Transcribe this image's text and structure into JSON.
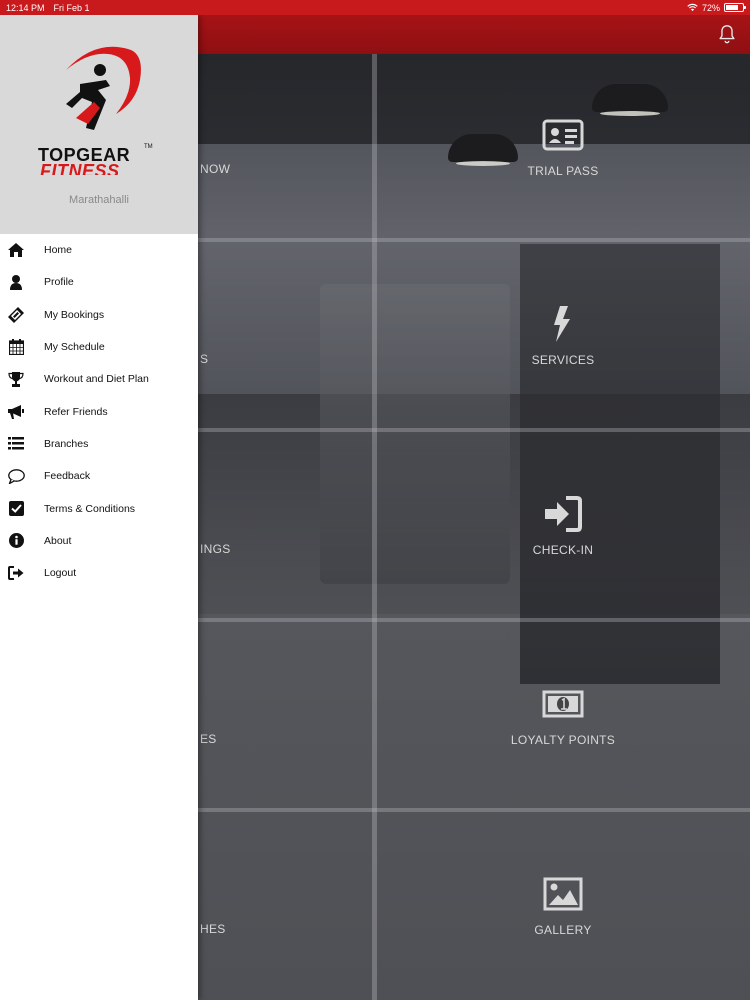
{
  "status_bar": {
    "time": "12:14 PM",
    "date": "Fri Feb 1",
    "battery": "72%",
    "battery_level": 0.72
  },
  "app_bar": {
    "icons": [
      "bell-icon"
    ]
  },
  "drawer": {
    "logo": {
      "line1": "TOPGEAR",
      "line2": "FITNESS",
      "mark": "TM"
    },
    "branch": "Marathahalli",
    "items": [
      {
        "label": "Home",
        "icon": "home-icon"
      },
      {
        "label": "Profile",
        "icon": "user-icon"
      },
      {
        "label": "My Bookings",
        "icon": "ticket-icon"
      },
      {
        "label": "My Schedule",
        "icon": "calendar-icon"
      },
      {
        "label": "Workout and Diet Plan",
        "icon": "trophy-icon"
      },
      {
        "label": "Refer Friends",
        "icon": "megaphone-icon"
      },
      {
        "label": "Branches",
        "icon": "list-icon"
      },
      {
        "label": "Feedback",
        "icon": "chat-icon"
      },
      {
        "label": "Terms & Conditions",
        "icon": "checkbox-icon"
      },
      {
        "label": "About",
        "icon": "info-icon"
      },
      {
        "label": "Logout",
        "icon": "logout-icon"
      }
    ]
  },
  "tiles": {
    "left": [
      {
        "label": "NOW"
      },
      {
        "label": "S"
      },
      {
        "label": "INGS"
      },
      {
        "label": "ES"
      },
      {
        "label": "HES"
      }
    ],
    "right": [
      {
        "label": "TRIAL PASS",
        "icon": "id-card-icon"
      },
      {
        "label": "SERVICES",
        "icon": "lightning-icon"
      },
      {
        "label": "CHECK-IN",
        "icon": "sign-in-icon"
      },
      {
        "label": "LOYALTY POINTS",
        "icon": "money-icon"
      },
      {
        "label": "GALLERY",
        "icon": "image-icon"
      }
    ]
  },
  "colors": {
    "accent": "#c8191c",
    "app_bar": "#9b1114",
    "drawer_header": "#d9d9d9"
  }
}
